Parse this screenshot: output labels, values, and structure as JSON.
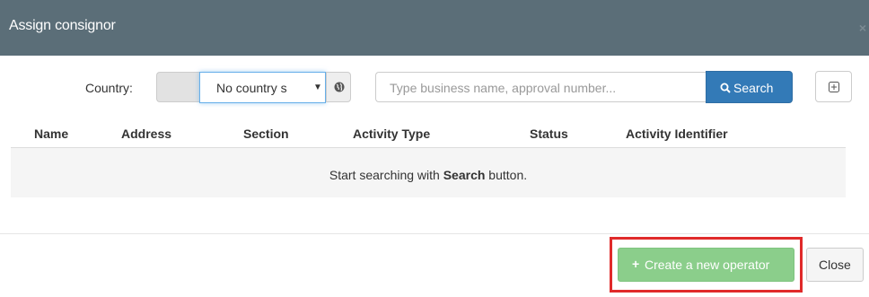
{
  "dialog": {
    "title": "Assign consignor",
    "close_glyph": "×"
  },
  "filters": {
    "country_label": "Country:",
    "country_value": "No country s",
    "country_caret": "▼",
    "globe_icon": "globe-icon",
    "search_placeholder": "Type business name, approval number...",
    "search_button_label": "Search",
    "expand_icon": "plus-square-icon"
  },
  "table": {
    "columns": [
      "Name",
      "Address",
      "Section",
      "Activity Type",
      "Status",
      "Activity Identifier"
    ],
    "empty_prefix": "Start searching with ",
    "empty_bold": "Search",
    "empty_suffix": " button."
  },
  "footer": {
    "create_plus": "+",
    "create_label": "Create a new operator",
    "close_label": "Close"
  },
  "colors": {
    "header_bg": "#5b6e78",
    "primary": "#337ab7",
    "success_disabled": "#8bce8b",
    "highlight": "#e02a2a"
  }
}
